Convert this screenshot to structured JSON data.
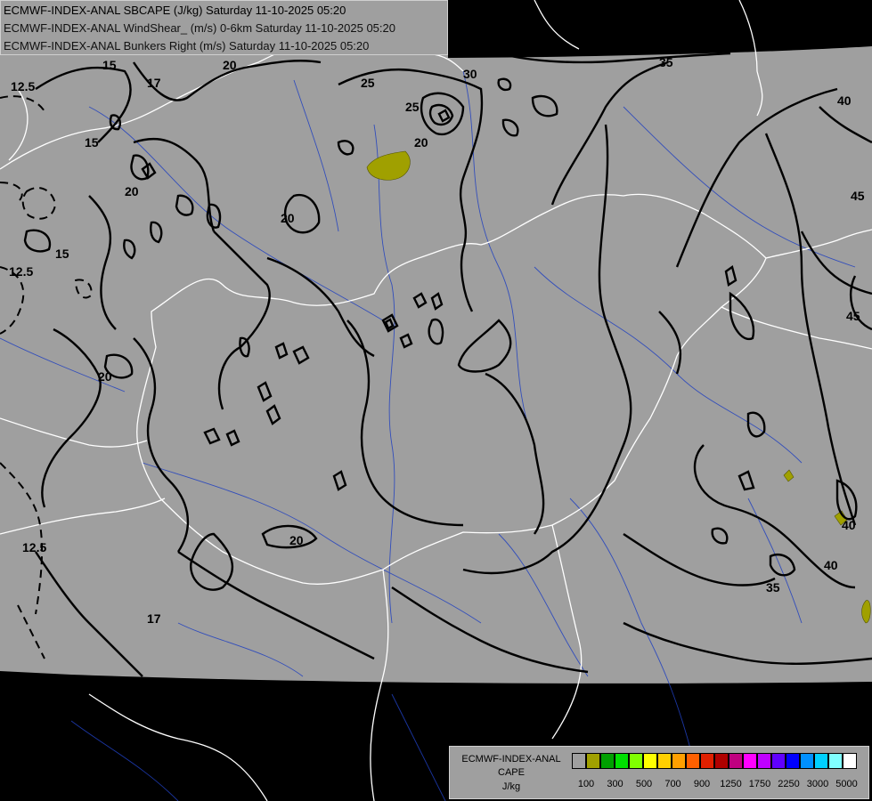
{
  "header": {
    "line1": "ECMWF-INDEX-ANAL SBCAPE (J/kg) Saturday 11-10-2025 05:20",
    "line2": "ECMWF-INDEX-ANAL WindShear_ (m/s) 0-6km Saturday 11-10-2025 05:20",
    "line3": "ECMWF-INDEX-ANAL Bunkers Right (m/s) Saturday 11-10-2025 05:20"
  },
  "legend": {
    "line1": "ECMWF-INDEX-ANAL",
    "line2": "CAPE",
    "line3": "J/kg",
    "colors": [
      "#9f9f9f",
      "#a0a000",
      "#00a000",
      "#00e000",
      "#80ff00",
      "#ffff00",
      "#ffd000",
      "#ffa000",
      "#ff6000",
      "#e02000",
      "#b00000",
      "#c00080",
      "#ff00ff",
      "#c000ff",
      "#6000ff",
      "#0000ff",
      "#0090ff",
      "#00d0ff",
      "#80ffff",
      "#ffffff"
    ],
    "ticks": [
      "100",
      "300",
      "500",
      "700",
      "900",
      "1250",
      "1750",
      "2250",
      "3000",
      "5000"
    ]
  },
  "contour_labels": [
    "12.5",
    "15",
    "17",
    "20",
    "25",
    "30",
    "35",
    "40",
    "45",
    "12.5",
    "15",
    "20",
    "25",
    "20",
    "20",
    "12.5",
    "17",
    "20",
    "35",
    "40",
    "40",
    "45",
    "15",
    "20"
  ],
  "map": {
    "background": "#000000",
    "field_fill": "#9f9f9f",
    "cape_fill": "#a0a000",
    "border_color": "#ffffff",
    "river_color": "#2040c0",
    "contour_color": "#000000"
  }
}
